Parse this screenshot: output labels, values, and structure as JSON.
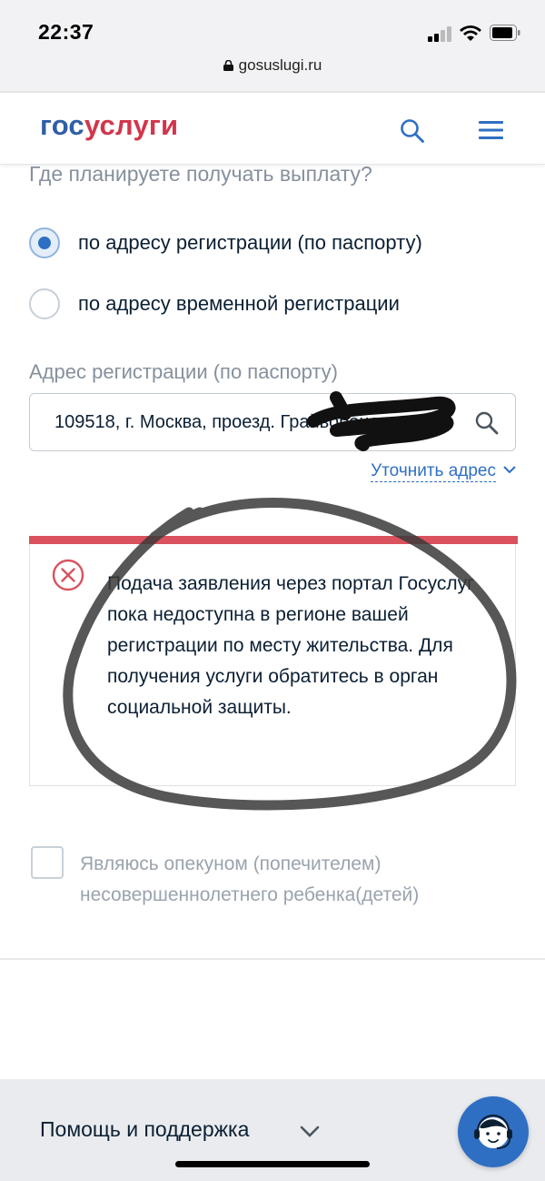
{
  "status_bar": {
    "time": "22:37"
  },
  "browser": {
    "url": "gosuslugi.ru"
  },
  "header": {
    "logo_part1": "гос",
    "logo_part2": "услуги"
  },
  "form": {
    "question": "Где планируете получать выплату?",
    "radio_options": [
      {
        "label": "по адресу регистрации (по паспорту)",
        "checked": true
      },
      {
        "label": "по адресу временной регистрации",
        "checked": false
      }
    ],
    "address_label": "Адрес регистрации (по паспорту)",
    "address_value": "109518, г. Москва, проезд. Грайвороновск",
    "refine_link": "Уточнить адрес"
  },
  "alert": {
    "type": "error",
    "text": "Подача заявления через портал Госуслуг пока недоступна в регионе вашей регистрации по месту жительства. Для получения услуги обратитесь в орган социальной защиты."
  },
  "guardian_checkbox": {
    "label": "Являюсь опекуном (попечителем) несовершеннолетнего ребенка(детей)",
    "checked": false
  },
  "footer": {
    "help_label": "Помощь и поддержка"
  },
  "colors": {
    "brand_blue": "#2f5ea8",
    "brand_red": "#d1364a",
    "link": "#2f6fc3",
    "error": "#d9525e"
  }
}
